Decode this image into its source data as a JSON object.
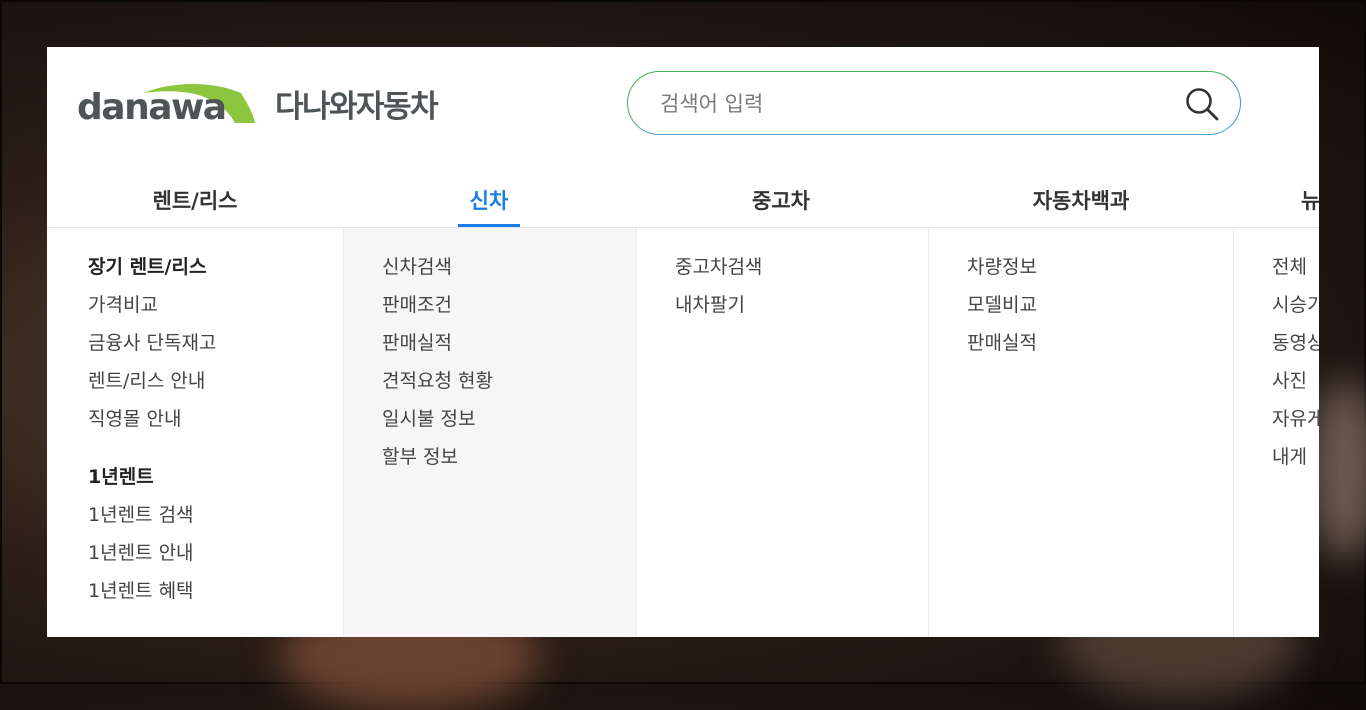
{
  "brand": {
    "logo_text": "danawa",
    "name": "다나와자동차",
    "swoosh_color": "#8cc63f"
  },
  "search": {
    "placeholder": "검색어 입력",
    "value": "",
    "border_color_left": "#3fb34f",
    "border_color_right": "#3b8fd8",
    "icon": "search-icon"
  },
  "nav": {
    "active_color": "#1a7ee8",
    "tabs": [
      {
        "label": "렌트/리스"
      },
      {
        "label": "신차",
        "active": true
      },
      {
        "label": "중고차"
      },
      {
        "label": "자동차백과"
      },
      {
        "label": "뉴"
      }
    ]
  },
  "dropdown": {
    "columns": [
      {
        "groups": [
          {
            "heading": "장기 렌트/리스",
            "items": [
              "가격비교",
              "금융사 단독재고",
              "렌트/리스 안내",
              "직영몰 안내"
            ]
          },
          {
            "heading": "1년렌트",
            "items": [
              "1년렌트 검색",
              "1년렌트 안내",
              "1년렌트 혜택"
            ]
          }
        ]
      },
      {
        "groups": [
          {
            "items": [
              "신차검색",
              "판매조건",
              "판매실적",
              "견적요청 현황",
              "일시불 정보",
              "할부 정보"
            ]
          }
        ]
      },
      {
        "groups": [
          {
            "items": [
              "중고차검색",
              "내차팔기"
            ]
          }
        ]
      },
      {
        "groups": [
          {
            "items": [
              "차량정보",
              "모델비교",
              "판매실적"
            ]
          }
        ]
      },
      {
        "groups": [
          {
            "items": [
              "전체",
              "시승기",
              "동영상",
              "사진",
              "자유게",
              "내게"
            ]
          }
        ]
      }
    ]
  }
}
